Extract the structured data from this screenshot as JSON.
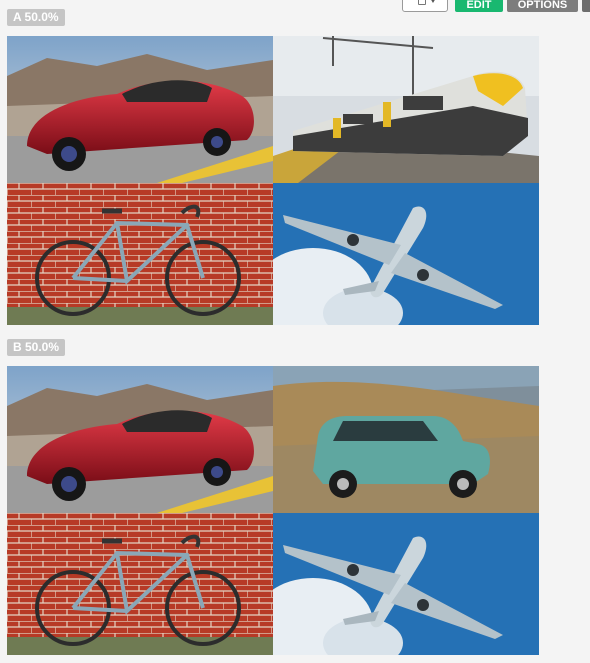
{
  "toolbar": {
    "edit_label": "EDIT",
    "options_label": "OPTIONS"
  },
  "variants": [
    {
      "label": "A 50.0%",
      "images": [
        "car-icon",
        "train-icon",
        "bicycle-icon",
        "airplane-icon"
      ]
    },
    {
      "label": "B 50.0%",
      "images": [
        "car-icon",
        "mini-car-icon",
        "bicycle-icon",
        "airplane-icon"
      ]
    }
  ]
}
